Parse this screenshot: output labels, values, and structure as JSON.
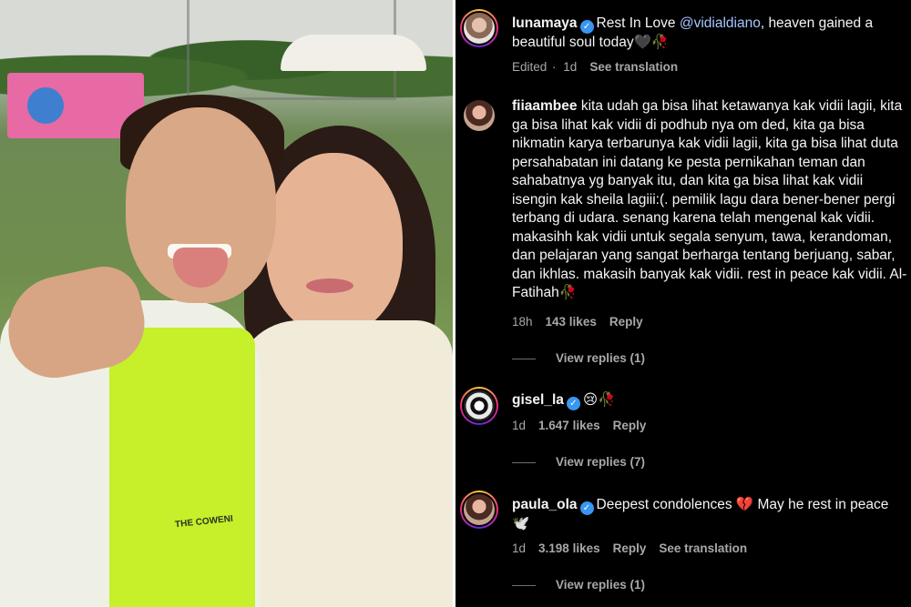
{
  "photo": {
    "shirt_print": "THE COWENI"
  },
  "comments": [
    {
      "username": "lunamaya",
      "verified": true,
      "text_before": "Rest In Love ",
      "mention": "@vidialdiano",
      "text_after": ", heaven gained a beautiful soul today🖤🥀",
      "meta": {
        "edited": "Edited",
        "time": "1d",
        "translate": "See translation"
      }
    },
    {
      "username": "fiiaambee",
      "verified": false,
      "text": "kita udah ga bisa lihat ketawanya kak vidii lagii, kita ga bisa lihat kak vidii di podhub nya om ded, kita ga bisa nikmatin karya terbarunya kak vidii lagii, kita ga bisa lihat duta persahabatan ini datang ke pesta pernikahan teman dan sahabatnya yg banyak itu, dan kita ga bisa lihat kak vidii isengin kak sheila lagiii:(. pemilik lagu dara bener-bener pergi terbang di udara. senang karena telah mengenal kak vidii. makasihh kak vidii untuk segala senyum, tawa, kerandoman, dan pelajaran yang sangat berharga tentang berjuang, sabar, dan ikhlas. makasih banyak kak vidii. rest in peace kak vidii. Al-Fatihah🥀",
      "meta": {
        "time": "18h",
        "likes": "143 likes",
        "reply": "Reply"
      },
      "view_replies": "View replies (1)"
    },
    {
      "username": "gisel_la",
      "verified": true,
      "text": "😢🥀",
      "meta": {
        "time": "1d",
        "likes": "1.647 likes",
        "reply": "Reply"
      },
      "view_replies": "View replies (7)"
    },
    {
      "username": "paula_ola",
      "verified": true,
      "text": "Deepest condolences 💔 May he rest in peace 🕊️",
      "meta": {
        "time": "1d",
        "likes": "3.198 likes",
        "reply": "Reply",
        "translate": "See translation"
      },
      "view_replies": "View replies (1)"
    }
  ],
  "icons": {
    "verified": "verified-badge-icon"
  },
  "colors": {
    "background": "#000000",
    "text": "#f5f5f5",
    "meta": "#a8a8a8",
    "mention": "#a6c8ff",
    "verified": "#3897f0"
  }
}
